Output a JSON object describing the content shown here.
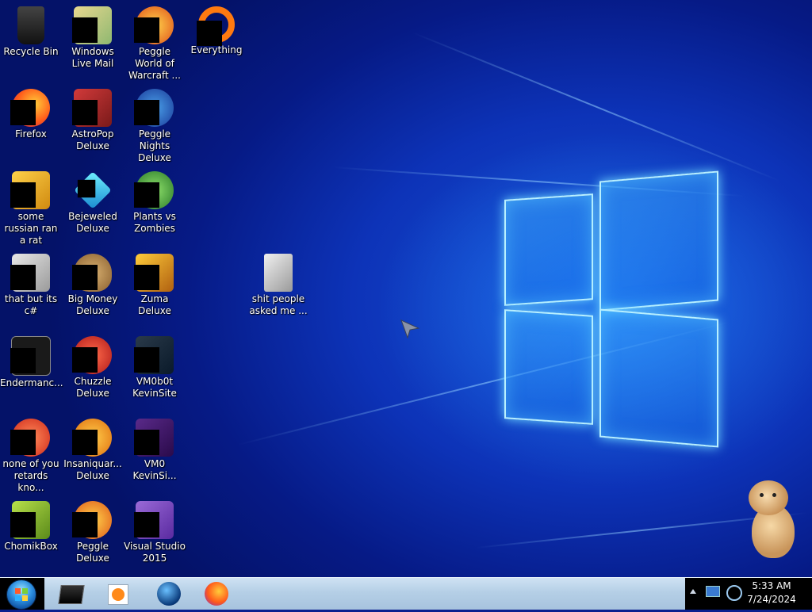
{
  "desktop": {
    "icons": [
      {
        "label": "Recycle Bin",
        "icon": "recycle-bin-icon"
      },
      {
        "label": "Windows Live Mail",
        "icon": "mail-icon"
      },
      {
        "label": "Peggle World of Warcraft ...",
        "icon": "peggle-icon"
      },
      {
        "label": "Everything",
        "icon": "search-icon"
      },
      {
        "label": "Firefox",
        "icon": "firefox-icon"
      },
      {
        "label": "AstroPop Deluxe",
        "icon": "astropop-icon"
      },
      {
        "label": "Peggle Nights Deluxe",
        "icon": "peggle-nights-icon"
      },
      {
        "label": "some russian ran a rat",
        "icon": "yellow-app-icon"
      },
      {
        "label": "Bejeweled Deluxe",
        "icon": "gem-icon"
      },
      {
        "label": "Plants vs Zombies",
        "icon": "plant-icon"
      },
      {
        "label": "that but its c#",
        "icon": "window-stack-icon"
      },
      {
        "label": "Big Money Deluxe",
        "icon": "money-bag-icon"
      },
      {
        "label": "Zuma Deluxe",
        "icon": "zuma-icon"
      },
      {
        "label": "shit people asked me ...",
        "icon": "folder-icon"
      },
      {
        "label": "Endermanc...",
        "icon": "terminal-icon"
      },
      {
        "label": "Chuzzle Deluxe",
        "icon": "chuzzle-icon"
      },
      {
        "label": "VM0b0t KevinSite",
        "icon": "vm-icon"
      },
      {
        "label": "none of you retards kno...",
        "icon": "red-ball-icon"
      },
      {
        "label": "Insaniquar... Deluxe",
        "icon": "fish-icon"
      },
      {
        "label": "VM0 KevinSi...",
        "icon": "vm-purple-icon"
      },
      {
        "label": "ChomikBox",
        "icon": "hamster-app-icon"
      },
      {
        "label": "Peggle Deluxe",
        "icon": "peggle-deluxe-icon"
      },
      {
        "label": "Visual Studio 2015",
        "icon": "visual-studio-icon"
      }
    ]
  },
  "taskbar": {
    "pinned": [
      {
        "icon": "black-monitor-icon"
      },
      {
        "icon": "media-player-icon"
      },
      {
        "icon": "globe-icon"
      },
      {
        "icon": "firefox-icon"
      }
    ],
    "clock": {
      "time": "5:33 AM",
      "date": "7/24/2024"
    }
  },
  "colors": {
    "wallpaper_accent": "#1554d6",
    "taskbar": "#b5cfe6",
    "glow": "#6fd6ff"
  }
}
